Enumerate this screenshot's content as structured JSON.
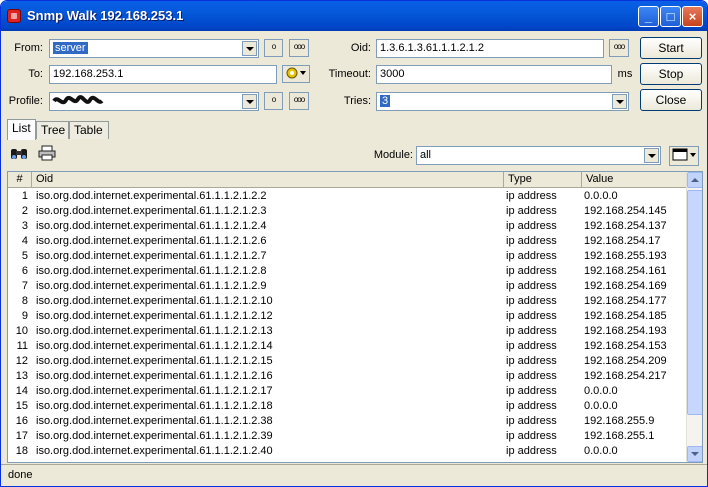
{
  "window": {
    "title": "Snmp Walk 192.168.253.1"
  },
  "form": {
    "from_label": "From:",
    "from_value": "server",
    "to_label": "To:",
    "to_value": "192.168.253.1",
    "profile_label": "Profile:",
    "profile_value": "",
    "oid_label": "Oid:",
    "oid_value": "1.3.6.1.3.61.1.1.2.1.2",
    "timeout_label": "Timeout:",
    "timeout_value": "3000",
    "timeout_unit": "ms",
    "tries_label": "Tries:",
    "tries_value": "3"
  },
  "buttons": {
    "start": "Start",
    "stop": "Stop",
    "close": "Close",
    "browse": "ooo",
    "small": "o"
  },
  "tabs": [
    "List",
    "Tree",
    "Table"
  ],
  "toolbar": {
    "module_label": "Module:",
    "module_value": "all"
  },
  "table": {
    "columns": [
      "#",
      "Oid",
      "Type",
      "Value"
    ],
    "rows": [
      [
        "1",
        "iso.org.dod.internet.experimental.61.1.1.2.1.2.2",
        "ip address",
        "0.0.0.0"
      ],
      [
        "2",
        "iso.org.dod.internet.experimental.61.1.1.2.1.2.3",
        "ip address",
        "192.168.254.145"
      ],
      [
        "3",
        "iso.org.dod.internet.experimental.61.1.1.2.1.2.4",
        "ip address",
        "192.168.254.137"
      ],
      [
        "4",
        "iso.org.dod.internet.experimental.61.1.1.2.1.2.6",
        "ip address",
        "192.168.254.17"
      ],
      [
        "5",
        "iso.org.dod.internet.experimental.61.1.1.2.1.2.7",
        "ip address",
        "192.168.255.193"
      ],
      [
        "6",
        "iso.org.dod.internet.experimental.61.1.1.2.1.2.8",
        "ip address",
        "192.168.254.161"
      ],
      [
        "7",
        "iso.org.dod.internet.experimental.61.1.1.2.1.2.9",
        "ip address",
        "192.168.254.169"
      ],
      [
        "8",
        "iso.org.dod.internet.experimental.61.1.1.2.1.2.10",
        "ip address",
        "192.168.254.177"
      ],
      [
        "9",
        "iso.org.dod.internet.experimental.61.1.1.2.1.2.12",
        "ip address",
        "192.168.254.185"
      ],
      [
        "10",
        "iso.org.dod.internet.experimental.61.1.1.2.1.2.13",
        "ip address",
        "192.168.254.193"
      ],
      [
        "11",
        "iso.org.dod.internet.experimental.61.1.1.2.1.2.14",
        "ip address",
        "192.168.254.153"
      ],
      [
        "12",
        "iso.org.dod.internet.experimental.61.1.1.2.1.2.15",
        "ip address",
        "192.168.254.209"
      ],
      [
        "13",
        "iso.org.dod.internet.experimental.61.1.1.2.1.2.16",
        "ip address",
        "192.168.254.217"
      ],
      [
        "14",
        "iso.org.dod.internet.experimental.61.1.1.2.1.2.17",
        "ip address",
        "0.0.0.0"
      ],
      [
        "15",
        "iso.org.dod.internet.experimental.61.1.1.2.1.2.18",
        "ip address",
        "0.0.0.0"
      ],
      [
        "16",
        "iso.org.dod.internet.experimental.61.1.1.2.1.2.38",
        "ip address",
        "192.168.255.9"
      ],
      [
        "17",
        "iso.org.dod.internet.experimental.61.1.1.2.1.2.39",
        "ip address",
        "192.168.255.1"
      ],
      [
        "18",
        "iso.org.dod.internet.experimental.61.1.1.2.1.2.40",
        "ip address",
        "0.0.0.0"
      ]
    ]
  },
  "status": {
    "text": "done"
  },
  "icons": {
    "app": "app-icon",
    "find": "binoculars-icon",
    "print": "print-icon",
    "settings": "gear-icon",
    "columns": "columns-icon"
  }
}
